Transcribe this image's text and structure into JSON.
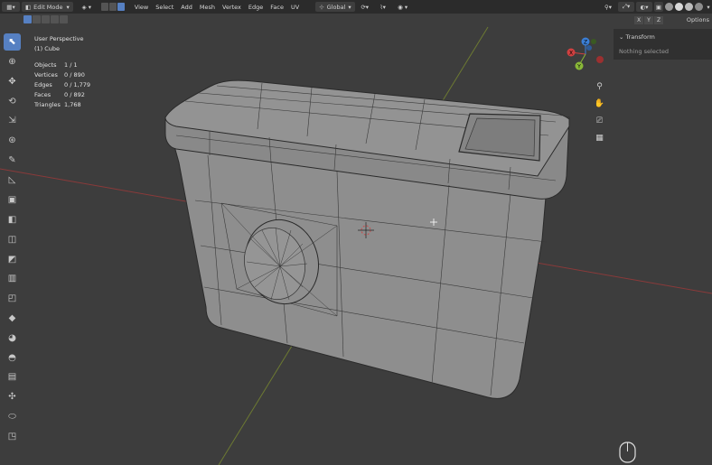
{
  "header": {
    "mode": "Edit Mode",
    "menus": [
      "View",
      "Select",
      "Add",
      "Mesh",
      "Vertex",
      "Edge",
      "Face",
      "UV"
    ],
    "orientation": "Global"
  },
  "viewport": {
    "view_name": "User Perspective",
    "object_name": "(1) Cube",
    "stats": [
      {
        "label": "Objects",
        "value": "1 / 1"
      },
      {
        "label": "Vertices",
        "value": "0 / 890"
      },
      {
        "label": "Edges",
        "value": "0 / 1,779"
      },
      {
        "label": "Faces",
        "value": "0 / 892"
      },
      {
        "label": "Triangles",
        "value": "1,768"
      }
    ]
  },
  "axis_toggles": [
    "X",
    "Y",
    "Z"
  ],
  "options_label": "Options",
  "sidebar": {
    "panel_title": "Transform",
    "panel_content": "Nothing selected"
  },
  "gizmo_labels": {
    "x": "X",
    "y": "Y",
    "z": "Z"
  },
  "colors": {
    "active": "#5680c2",
    "x_axis": "#d04040",
    "y_axis": "#8ab838",
    "z_axis": "#3b7fd6"
  }
}
